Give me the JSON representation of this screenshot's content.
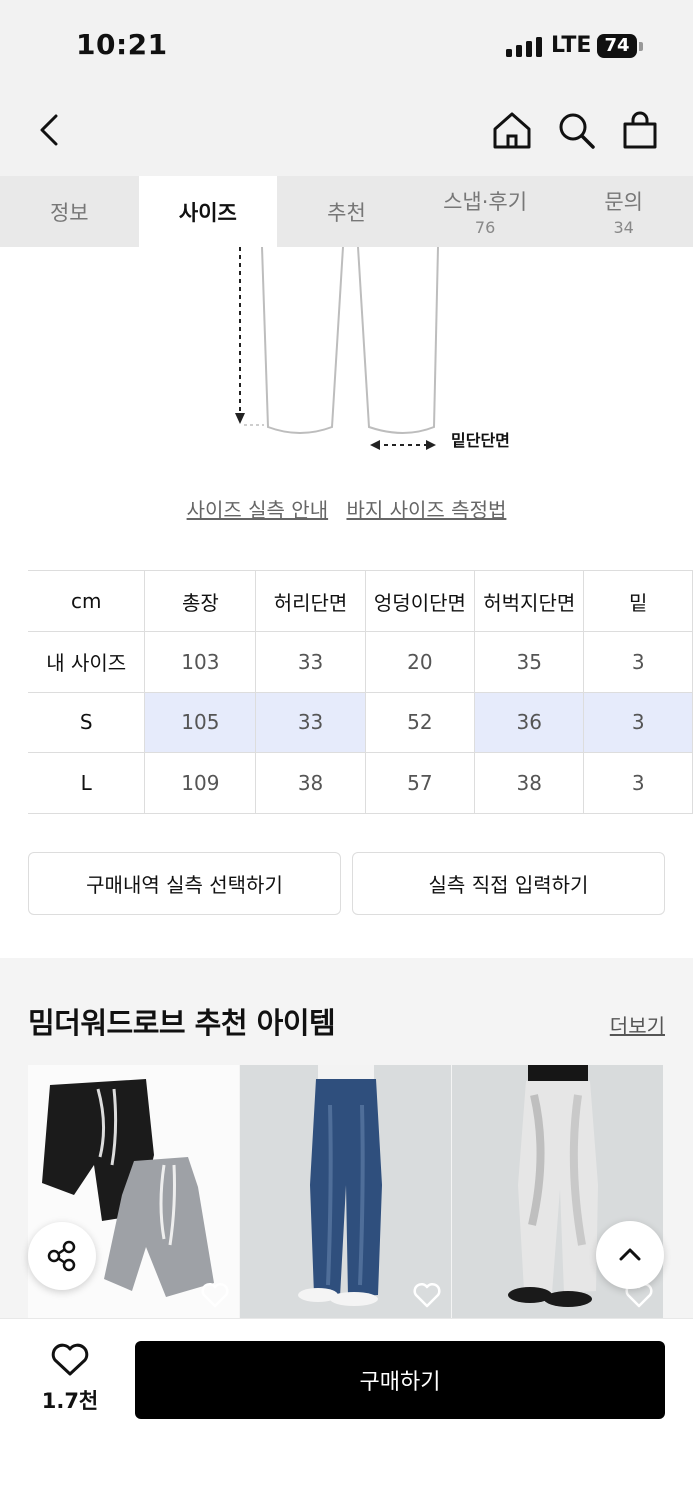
{
  "status_bar": {
    "time": "10:21",
    "network": "LTE",
    "battery": "74"
  },
  "header": {
    "icons": [
      "back-icon",
      "home-icon",
      "search-icon",
      "cart-icon"
    ]
  },
  "tabs": [
    {
      "label": "정보",
      "count": ""
    },
    {
      "label": "사이즈",
      "count": "",
      "active": true
    },
    {
      "label": "추천",
      "count": ""
    },
    {
      "label": "스냅·후기",
      "count": "76"
    },
    {
      "label": "문의",
      "count": "34"
    }
  ],
  "diagram": {
    "label": "밑단단면"
  },
  "guide_links": {
    "measure_guide": "사이즈 실측 안내",
    "pants_guide": "바지 사이즈 측정법"
  },
  "size_table": {
    "headers": [
      "cm",
      "총장",
      "허리단면",
      "엉덩이단면",
      "허벅지단면",
      "밑"
    ],
    "rows": [
      {
        "label": "내 사이즈",
        "cells": [
          "103",
          "33",
          "20",
          "35",
          "3"
        ]
      },
      {
        "label": "S",
        "cells": [
          "105",
          "33",
          "52",
          "36",
          "3"
        ]
      },
      {
        "label": "L",
        "cells": [
          "109",
          "38",
          "57",
          "38",
          "3"
        ]
      }
    ]
  },
  "buttons": {
    "select_history": "구매내역 실측 선택하기",
    "direct_input": "실측 직접 입력하기"
  },
  "recommend": {
    "title": "밈더워드로브 추천 아이템",
    "more": "더보기",
    "products": [
      "black-and-grey-shorts",
      "blue-denim-jeans",
      "white-wide-pants"
    ]
  },
  "bottom": {
    "like_count": "1.7천",
    "buy_label": "구매하기"
  }
}
